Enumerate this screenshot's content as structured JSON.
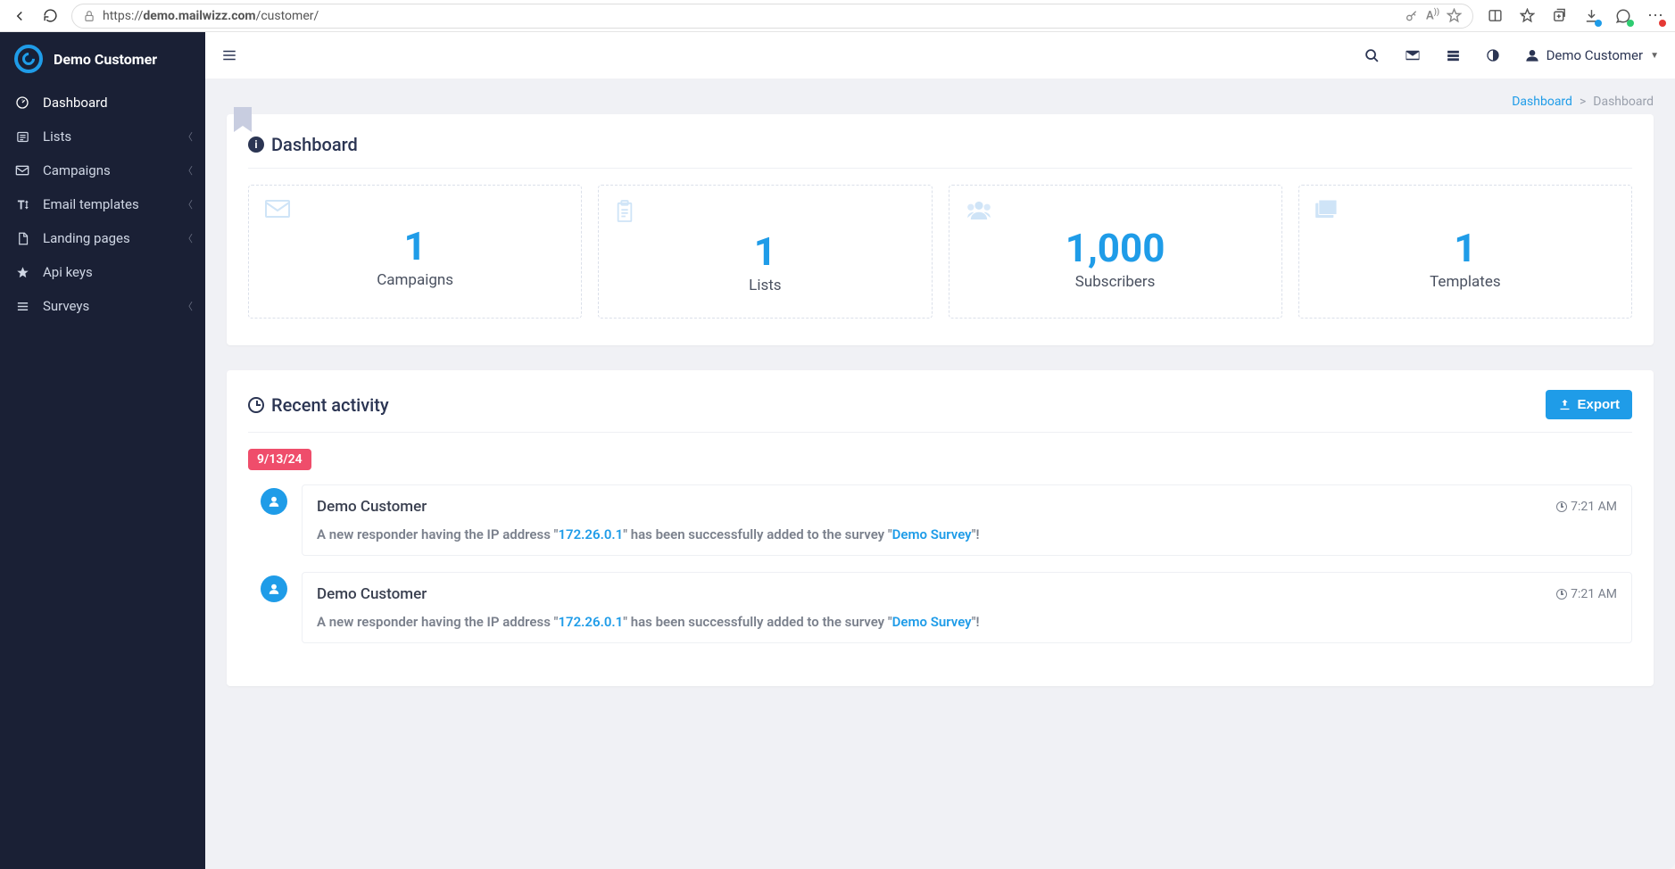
{
  "browser": {
    "url_prefix": "https://",
    "url_bold": "demo.mailwizz.com",
    "url_rest": "/customer/"
  },
  "brand": {
    "name": "Demo Customer"
  },
  "sidebar": {
    "items": [
      {
        "label": "Dashboard",
        "icon": "gauge",
        "active": true,
        "expandable": false
      },
      {
        "label": "Lists",
        "icon": "list-alt",
        "active": false,
        "expandable": true
      },
      {
        "label": "Campaigns",
        "icon": "envelope",
        "active": false,
        "expandable": true
      },
      {
        "label": "Email templates",
        "icon": "text-height",
        "active": false,
        "expandable": true
      },
      {
        "label": "Landing pages",
        "icon": "file",
        "active": false,
        "expandable": true
      },
      {
        "label": "Api keys",
        "icon": "star",
        "active": false,
        "expandable": false
      },
      {
        "label": "Surveys",
        "icon": "bars",
        "active": false,
        "expandable": true
      }
    ]
  },
  "topbar": {
    "user": "Demo Customer"
  },
  "breadcrumb": {
    "link": "Dashboard",
    "current": "Dashboard"
  },
  "dashboard": {
    "title": "Dashboard",
    "stats": [
      {
        "value": "1",
        "label": "Campaigns",
        "icon": "envelope"
      },
      {
        "value": "1",
        "label": "Lists",
        "icon": "clipboard"
      },
      {
        "value": "1,000",
        "label": "Subscribers",
        "icon": "users"
      },
      {
        "value": "1",
        "label": "Templates",
        "icon": "windows"
      }
    ]
  },
  "recent": {
    "title": "Recent activity",
    "export_label": "Export",
    "date_badge": "9/13/24",
    "items": [
      {
        "user": "Demo Customer",
        "time": "7:21 AM",
        "msg_pre": "A new responder having the IP address \"",
        "ip": "172.26.0.1",
        "msg_mid": "\" has been successfully added to the survey \"",
        "survey": "Demo Survey",
        "msg_post": "\"!"
      },
      {
        "user": "Demo Customer",
        "time": "7:21 AM",
        "msg_pre": "A new responder having the IP address \"",
        "ip": "172.26.0.1",
        "msg_mid": "\" has been successfully added to the survey \"",
        "survey": "Demo Survey",
        "msg_post": "\"!"
      }
    ]
  }
}
